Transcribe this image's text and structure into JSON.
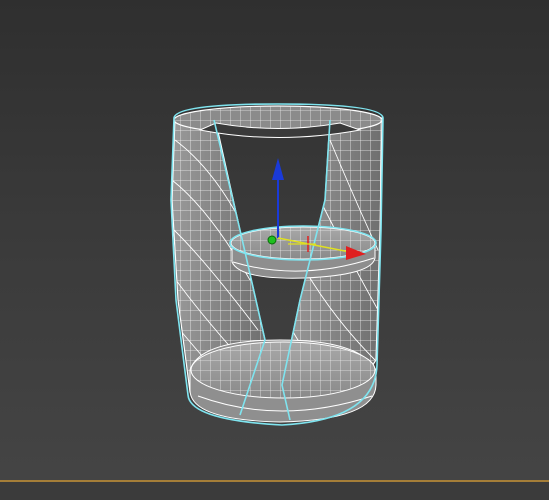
{
  "viewport": {
    "background": "#3a3a3a",
    "selection_color": "#7fe4ef",
    "wire_color": "#ffffff",
    "surface_color": "#8d8d8d"
  },
  "object": {
    "type": "cylindrical side table with middle shelf",
    "selected": true
  },
  "gizmo": {
    "x_axis_color": "#e02020",
    "y_axis_color": "#e0e020",
    "z_axis_color": "#1a3ad8",
    "pivot_color": "#20c020"
  },
  "timeline_bar_color": "#a57e38"
}
